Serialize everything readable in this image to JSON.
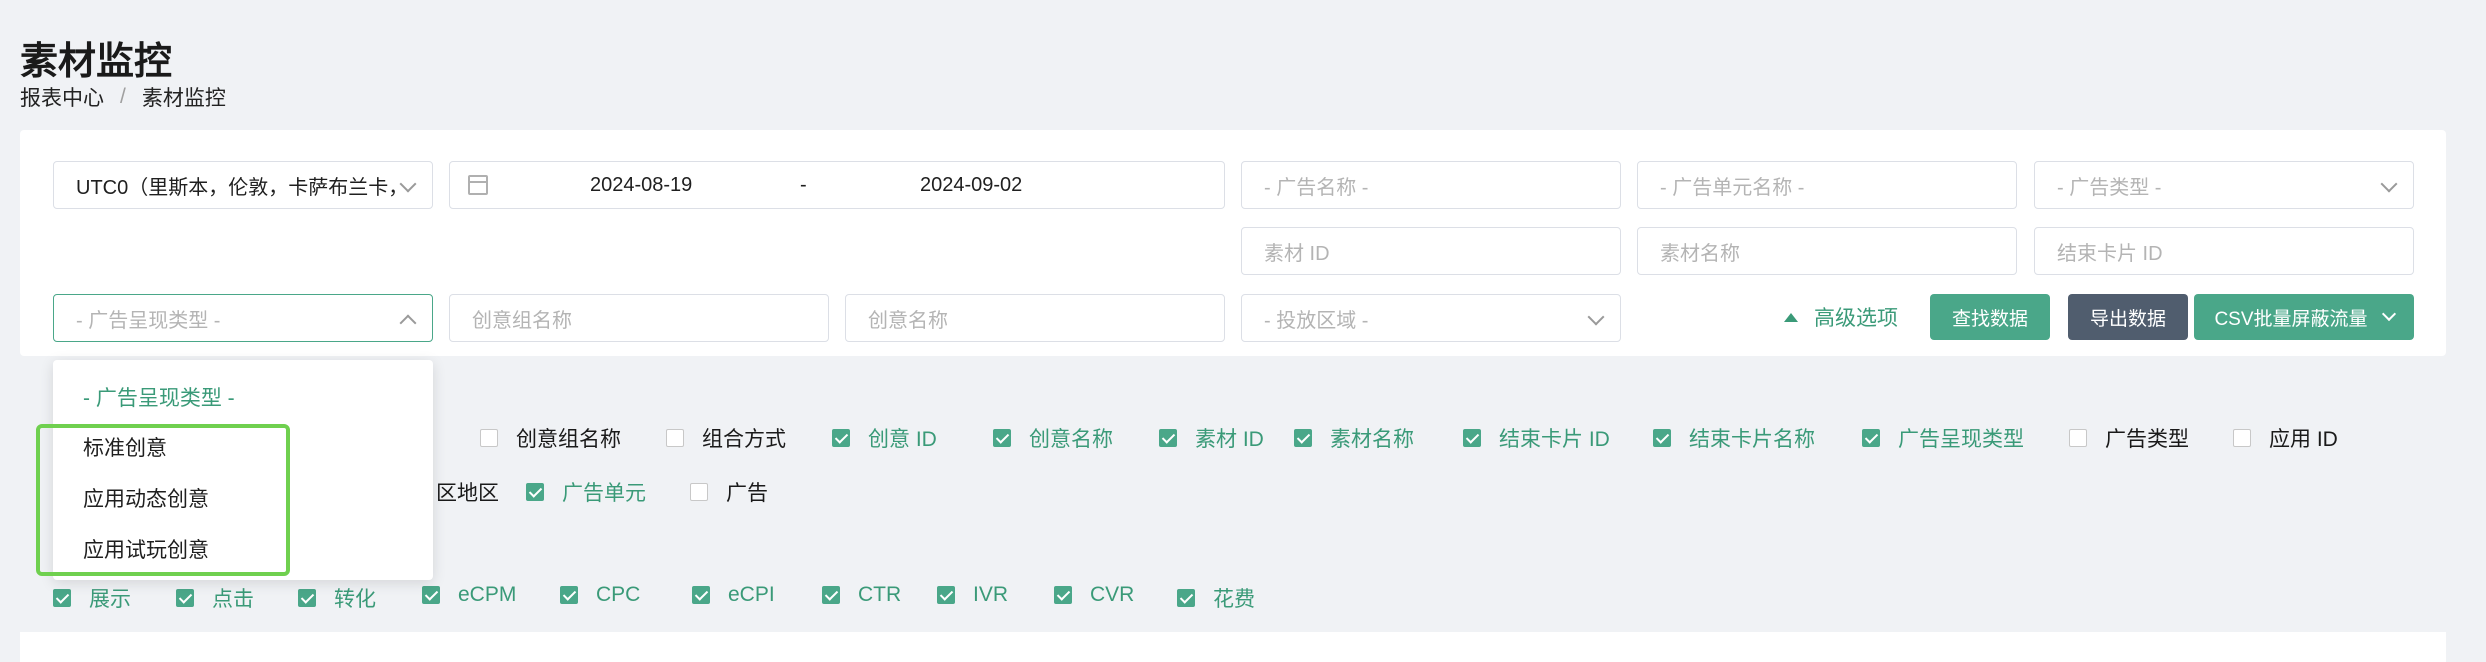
{
  "page": {
    "title": "素材监控",
    "breadcrumb": [
      "报表中心",
      "/",
      "素材监控"
    ]
  },
  "filters": {
    "timezone": "UTC0（里斯本，伦敦，卡萨布兰卡，",
    "date_start": "2024-08-19",
    "date_sep": "-",
    "date_end": "2024-09-02",
    "ad_name_placeholder": "- 广告名称 -",
    "ad_unit_name_placeholder": "- 广告单元名称 -",
    "ad_type_placeholder": "- 广告类型 -",
    "material_id_placeholder": "素材 ID",
    "material_name_placeholder": "素材名称",
    "end_card_id_placeholder": "结束卡片 ID",
    "ad_display_type_placeholder": "- 广告呈现类型 -",
    "creative_group_placeholder": "创意组名称",
    "creative_name_placeholder": "创意名称",
    "region_placeholder": "- 投放区域 -"
  },
  "actions": {
    "advanced": "高级选项",
    "query": "查找数据",
    "export": "导出数据",
    "csv_block": "CSV批量屏蔽流量"
  },
  "dimension_checks": [
    {
      "label": "创意组名称",
      "checked": false
    },
    {
      "label": "组合方式",
      "checked": false
    },
    {
      "label": "创意 ID",
      "checked": true
    },
    {
      "label": "创意名称",
      "checked": true
    },
    {
      "label": "素材 ID",
      "checked": true
    },
    {
      "label": "素材名称",
      "checked": true
    },
    {
      "label": "结束卡片 ID",
      "checked": true
    },
    {
      "label": "结束卡片名称",
      "checked": true
    },
    {
      "label": "广告呈现类型",
      "checked": true
    },
    {
      "label": "广告类型",
      "checked": false
    },
    {
      "label": "应用 ID",
      "checked": false
    }
  ],
  "dimension_checks_row2": [
    {
      "label": "区地区",
      "checked": false
    },
    {
      "label": "广告单元",
      "checked": true
    },
    {
      "label": "广告",
      "checked": false
    }
  ],
  "metric_checks": [
    {
      "label": "展示",
      "checked": true
    },
    {
      "label": "点击",
      "checked": true
    },
    {
      "label": "转化",
      "checked": true
    },
    {
      "label": "eCPM",
      "checked": true
    },
    {
      "label": "CPC",
      "checked": true
    },
    {
      "label": "eCPI",
      "checked": true
    },
    {
      "label": "CTR",
      "checked": true
    },
    {
      "label": "IVR",
      "checked": true
    },
    {
      "label": "CVR",
      "checked": true
    },
    {
      "label": "花费",
      "checked": true
    }
  ],
  "dropdown": {
    "options": [
      "- 广告呈现类型 -",
      "标准创意",
      "应用动态创意",
      "应用试玩创意"
    ]
  },
  "colors": {
    "accent": "#4aa789",
    "dark_button": "#505d6e",
    "highlight": "#6fd04f"
  }
}
